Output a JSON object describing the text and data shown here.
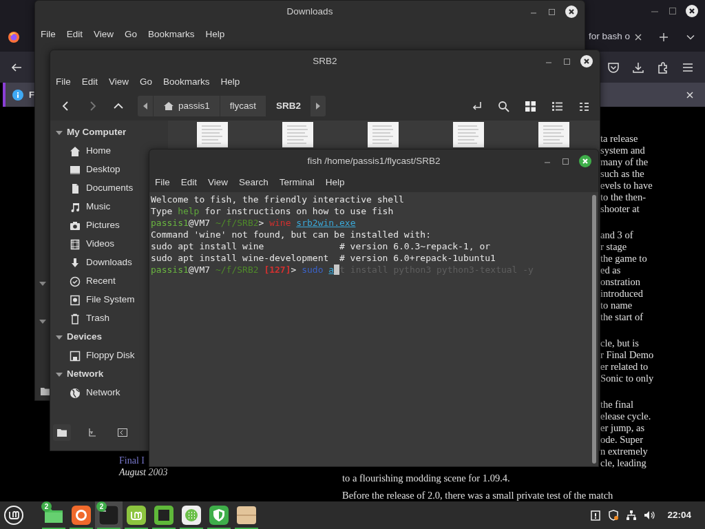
{
  "browser": {
    "tab": {
      "title": "for bash o"
    },
    "notification": {
      "text": "F"
    },
    "page": {
      "left_lines": [
        {
          "kind": "link",
          "text": "Final I"
        },
        {
          "kind": "italic",
          "text": "August 2003"
        }
      ],
      "right_paragraphs": [
        [
          "ta release",
          "system and",
          "many of the",
          "such as the",
          "evels to have",
          "to the then-",
          "shooter at"
        ],
        [
          "and 3 of",
          "r stage",
          "the game to",
          "ed as",
          "onstration",
          "introduced",
          "to name",
          "the start of"
        ],
        [
          "cle, but is",
          "r Final Demo",
          "er related to",
          "Sonic to only"
        ],
        [
          "the final",
          "elease cycle.",
          "er jump, as",
          "ode. Super",
          "n extremely",
          "cle, leading"
        ]
      ],
      "bottom_lines": [
        "to a flourishing modding scene for 1.09.4.",
        "Before the release of 2.0, there was a small private test of the match"
      ]
    }
  },
  "downloads_window": {
    "title": "Downloads",
    "menu": [
      "File",
      "Edit",
      "View",
      "Go",
      "Bookmarks",
      "Help"
    ]
  },
  "srb2_window": {
    "title": "SRB2",
    "menu": [
      "File",
      "Edit",
      "View",
      "Go",
      "Bookmarks",
      "Help"
    ],
    "nav_buttons": [
      {
        "disabled": false
      },
      {
        "disabled": true
      },
      {
        "disabled": false
      }
    ],
    "breadcrumb": [
      {
        "label": "passis1",
        "selected": false
      },
      {
        "label": "flycast",
        "selected": false
      },
      {
        "label": "SRB2",
        "selected": true
      }
    ],
    "sidebar": [
      {
        "label": "My Computer",
        "expanded": true,
        "items": [
          {
            "label": "Home"
          },
          {
            "label": "Desktop"
          },
          {
            "label": "Documents"
          },
          {
            "label": "Music"
          },
          {
            "label": "Pictures"
          },
          {
            "label": "Videos"
          },
          {
            "label": "Downloads"
          },
          {
            "label": "Recent"
          },
          {
            "label": "File System"
          },
          {
            "label": "Trash"
          }
        ]
      },
      {
        "label": "Devices",
        "expanded": true,
        "items": [
          {
            "label": "Floppy Disk"
          }
        ]
      },
      {
        "label": "Network",
        "expanded": true,
        "items": [
          {
            "label": "Network"
          }
        ]
      }
    ]
  },
  "terminal": {
    "title": "fish /home/passis1/flycast/SRB2",
    "menu": [
      "File",
      "Edit",
      "View",
      "Search",
      "Terminal",
      "Help"
    ],
    "lines": [
      [
        {
          "kind": "plain",
          "text": "Welcome to fish, the friendly interactive shell"
        }
      ],
      [
        {
          "kind": "plain",
          "text": "Type "
        },
        {
          "kind": "keyword",
          "text": "help"
        },
        {
          "kind": "plain",
          "text": " for instructions on how to use fish"
        }
      ],
      [
        {
          "kind": "user",
          "text": "passis1"
        },
        {
          "kind": "plain",
          "text": "@VM7"
        },
        {
          "kind": "path",
          "text": " ~/f/SRB2"
        },
        {
          "kind": "plain",
          "text": "> "
        },
        {
          "kind": "error",
          "text": "wine "
        },
        {
          "kind": "link",
          "text": "srb2win.exe"
        }
      ],
      [
        {
          "kind": "plain",
          "text": "Command 'wine' not found, but can be installed with:"
        }
      ],
      [
        {
          "kind": "plain",
          "text": "sudo apt install wine              # version 6.0.3~repack-1, or"
        }
      ],
      [
        {
          "kind": "plain",
          "text": "sudo apt install wine-development  # version 6.0+repack-1ubuntu1"
        }
      ],
      [
        {
          "kind": "user",
          "text": "passis1"
        },
        {
          "kind": "plain",
          "text": "@VM7"
        },
        {
          "kind": "path",
          "text": " ~/f/SRB2 "
        },
        {
          "kind": "status",
          "text": "[127]"
        },
        {
          "kind": "plain",
          "text": "> "
        },
        {
          "kind": "command",
          "text": "sudo "
        },
        {
          "kind": "link",
          "text": "a"
        },
        {
          "kind": "cursor"
        },
        {
          "kind": "hint",
          "text": "t install python3 python3-textual -y"
        }
      ]
    ]
  },
  "taskbar": {
    "apps": [
      {
        "badge": "2",
        "running": true,
        "active": false
      },
      {
        "running": true,
        "active": false
      },
      {
        "badge": "2",
        "running": true,
        "active": true
      },
      {
        "running": true,
        "active": false
      },
      {
        "running": true,
        "active": false
      },
      {
        "running": true,
        "active": false
      },
      {
        "running": true,
        "active": false
      },
      {
        "running": true,
        "active": false
      }
    ],
    "clock": "22:04"
  }
}
